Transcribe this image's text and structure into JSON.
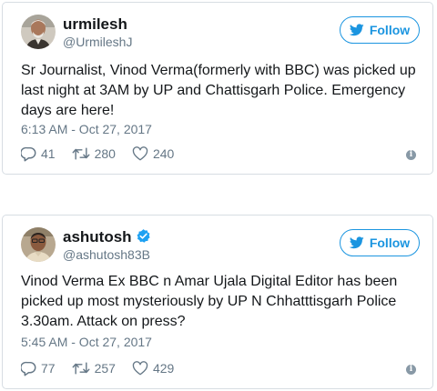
{
  "colors": {
    "accent": "#1b95e0",
    "muted_text": "#657786",
    "primary_text": "#14171a",
    "border": "#d7dde3",
    "verified_badge": "#1da1f2"
  },
  "tweets": [
    {
      "display_name": "urmilesh",
      "handle": "@UrmileshJ",
      "verified": false,
      "follow_label": "Follow",
      "text": "Sr Journalist, Vinod Verma(formerly with BBC) was picked up last night at 3AM by UP and Chattisgarh Police. Emergency days are here!",
      "timestamp": "6:13 AM - Oct 27, 2017",
      "replies": "41",
      "retweets": "280",
      "likes": "240",
      "icons": [
        "avatar",
        "twitter-bird-icon",
        "reply-icon",
        "retweet-icon",
        "like-icon",
        "info-icon"
      ]
    },
    {
      "display_name": "ashutosh",
      "handle": "@ashutosh83B",
      "verified": true,
      "follow_label": "Follow",
      "text": "Vinod Verma Ex BBC n Amar Ujala Digital Editor has been picked up most mysteriously by UP N Chhatttisgarh Police 3.30am. Attack on press?",
      "timestamp": "5:45 AM - Oct 27, 2017",
      "replies": "77",
      "retweets": "257",
      "likes": "429",
      "icons": [
        "avatar",
        "verified-badge-icon",
        "twitter-bird-icon",
        "reply-icon",
        "retweet-icon",
        "like-icon",
        "info-icon"
      ]
    }
  ]
}
